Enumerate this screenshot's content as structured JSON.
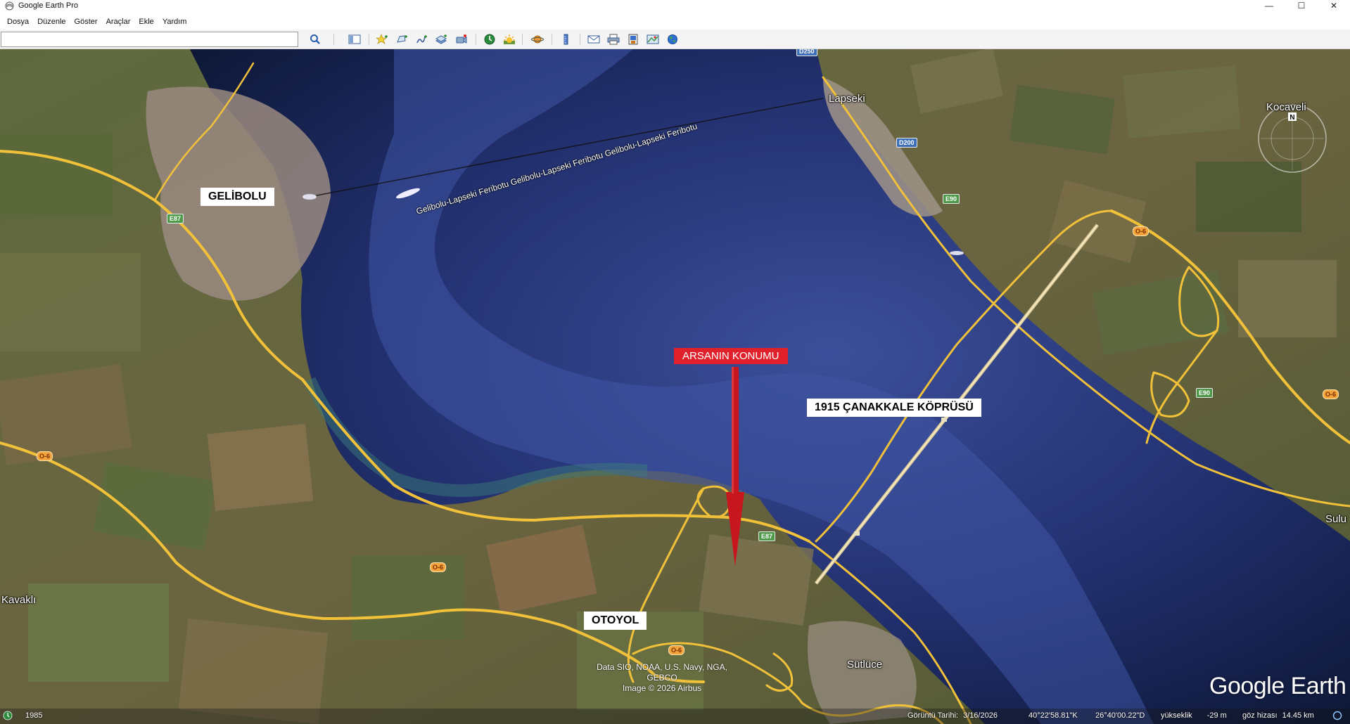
{
  "window": {
    "title": "Google Earth Pro",
    "controls": {
      "minimize": "—",
      "maximize": "☐",
      "close": "✕"
    }
  },
  "menu": {
    "items": [
      "Dosya",
      "Düzenle",
      "Göster",
      "Araçlar",
      "Ekle",
      "Yardım"
    ]
  },
  "search": {
    "value": "",
    "placeholder": ""
  },
  "toolbar": {
    "buttons": [
      "search-icon",
      "sidebar-icon",
      "placemark-icon",
      "polygon-icon",
      "path-icon",
      "image-overlay-icon",
      "record-tour-icon",
      "historical-imagery-icon",
      "sunlight-icon",
      "planets-icon",
      "ruler-icon",
      "email-icon",
      "print-icon",
      "save-image-icon",
      "view-in-maps-icon",
      "earth-icon"
    ]
  },
  "map": {
    "places": {
      "lapseki": "Lapseki",
      "kocaveli": "Kocaveli",
      "kavakli": "Kavaklı",
      "sutluce": "Sütlüce",
      "sulu": "Sulu"
    },
    "ferry_label": "Gelibolu-Lapseki Feribotu    Gelibolu-Lapseki Feribotu    Gelibolu-Lapseki Feribotu",
    "road_shields": {
      "e87_a": "E87",
      "e87_b": "E87",
      "d200": "D200",
      "d250": "D250",
      "e90_a": "E90",
      "e90_b": "E90",
      "o6_a": "O-6",
      "o6_b": "O-6",
      "o6_c": "O-6",
      "o6_d": "O-6",
      "o6_e": "O-6"
    },
    "annotations": {
      "gelibolu": "GELİBOLU",
      "arsanin_konumu": "ARSANIN KONUMU",
      "kopru": "1915 ÇANAKKALE KÖPRÜSÜ",
      "otoyol": "OTOYOL"
    },
    "attribution": [
      "Data SIO, NOAA, U.S. Navy, NGA, GEBCO",
      "Image © 2026 Airbus"
    ],
    "logo": "Google Earth",
    "colors": {
      "annotation_red": "#e0202a",
      "road_yellow": "#f2c13a",
      "water": "#1f2d6a"
    }
  },
  "status": {
    "year": "1985",
    "imagery_date_label": "Görüntü Tarihi:",
    "imagery_date": "3/16/2026",
    "lat": "40°22'58.81\"K",
    "lon": "26°40'00.22\"D",
    "elevation_label": "yükseklik",
    "elevation": "-29 m",
    "eye_alt_label": "göz hizası",
    "eye_alt": "14.45 km"
  }
}
